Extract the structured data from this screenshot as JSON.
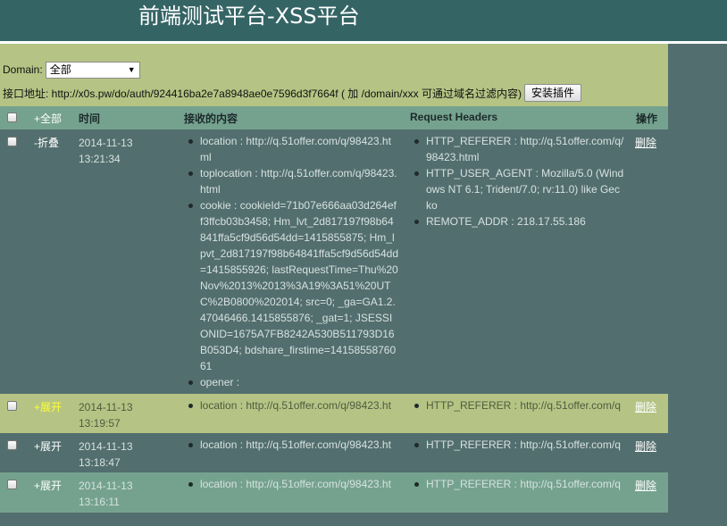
{
  "header": {
    "title": "前端测试平台-XSS平台"
  },
  "toolbar": {
    "domain_label": "Domain:",
    "domain_selected": "全部",
    "api_text": "接口地址: http://x0s.pw/do/auth/924416ba2e7a8948ae0e7596d3f7664f ( 加 /domain/xxx 可通过域名过滤内容)",
    "install_button": "安装插件"
  },
  "table": {
    "headers": {
      "all": "+全部",
      "time": "时间",
      "content": "接收的内容",
      "request_headers": "Request Headers",
      "ops": "操作"
    },
    "rows": [
      {
        "toggle": "-折叠",
        "date": "2014-11-13",
        "time": "13:21:34",
        "content": [
          "location : http://q.51offer.com/q/98423.html",
          "toplocation : http://q.51offer.com/q/98423.html",
          "cookie : cookieId=71b07e666aa03d264eff3ffcb03b3458; Hm_lvt_2d817197f98b64841ffa5cf9d56d54dd=1415855875; Hm_lpvt_2d817197f98b64841ffa5cf9d56d54dd=1415855926; lastRequestTime=Thu%20Nov%2013%2013%3A19%3A51%20UTC%2B0800%202014; src=0; _ga=GA1.2.47046466.1415855876; _gat=1; JSESSIONID=1675A7FB8242A530B511793D16B053D4; bdshare_firstime=1415855876061",
          "opener :"
        ],
        "headers": [
          "HTTP_REFERER : http://q.51offer.com/q/98423.html",
          "HTTP_USER_AGENT : Mozilla/5.0 (Windows NT 6.1; Trident/7.0; rv:11.0) like Gecko",
          "REMOTE_ADDR : 218.17.55.186"
        ],
        "delete": "删除"
      },
      {
        "toggle": "+展开",
        "date": "2014-11-13",
        "time": "13:19:57",
        "content": [
          "location : http://q.51offer.com/q/98423.ht"
        ],
        "headers": [
          "HTTP_REFERER : http://q.51offer.com/q"
        ],
        "delete": "删除"
      },
      {
        "toggle": "+展开",
        "date": "2014-11-13",
        "time": "13:18:47",
        "content": [
          "location : http://q.51offer.com/q/98423.ht"
        ],
        "headers": [
          "HTTP_REFERER : http://q.51offer.com/q"
        ],
        "delete": "删除"
      },
      {
        "toggle": "+展开",
        "date": "2014-11-13",
        "time": "13:16:11",
        "content": [
          "location : http://q.51offer.com/q/98423.ht"
        ],
        "headers": [
          "HTTP_REFERER : http://q.51offer.com/q"
        ],
        "delete": "删除"
      }
    ]
  }
}
